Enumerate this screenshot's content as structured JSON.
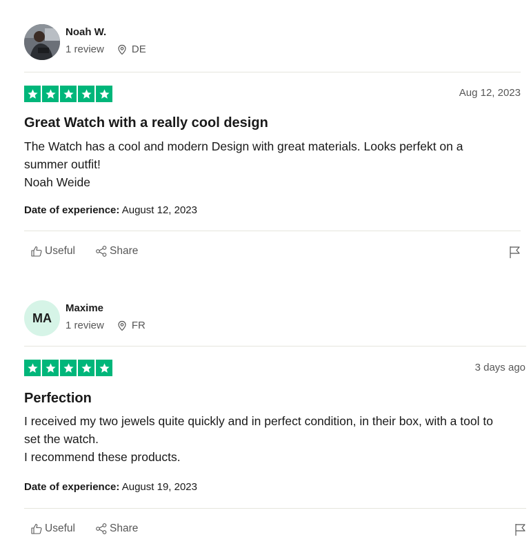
{
  "reviews": [
    {
      "consumer": {
        "name": "Noah W.",
        "reviews": "1 review",
        "country": "DE",
        "initials": ""
      },
      "rating_stars": 5,
      "date": "Aug 12, 2023",
      "title": "Great Watch with a really cool design",
      "body_lines": [
        "The Watch has a cool and modern Design with great materials. Looks perfekt on a summer outfit!",
        "Noah Weide"
      ],
      "experience_label": "Date of experience:",
      "experience_date": "August 12, 2023",
      "useful_label": "Useful",
      "share_label": "Share"
    },
    {
      "consumer": {
        "name": "Maxime",
        "reviews": "1 review",
        "country": "FR",
        "initials": "MA"
      },
      "rating_stars": 5,
      "date": "3 days ago",
      "title": "Perfection",
      "body_lines": [
        "I received my two jewels quite quickly and in perfect condition, in their box, with a tool to set the watch.",
        "I recommend these products."
      ],
      "experience_label": "Date of experience:",
      "experience_date": "August 19, 2023",
      "useful_label": "Useful",
      "share_label": "Share"
    }
  ],
  "colors": {
    "star_green": "#00b67a",
    "avatar_initials_bg": "#d6f4e7"
  },
  "icons": {
    "location": "location-pin-icon",
    "useful": "thumbs-up-icon",
    "share": "share-icon",
    "report": "flag-icon"
  }
}
